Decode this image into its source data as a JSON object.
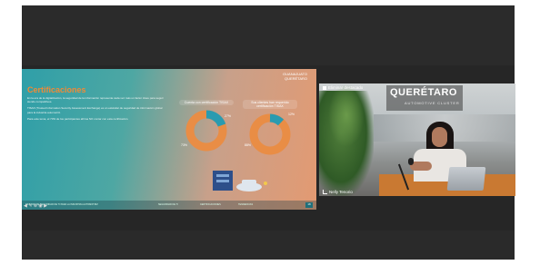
{
  "slide": {
    "logo_left": "GUANAJUATO",
    "logo_right": "QUERÉTARO",
    "title": "Certificaciones",
    "body": [
      "En la era de la digitalización, la seguridad de la información representa cada vez más un factor clave para seguir siendo competitivos.",
      "TISAX (Trusted Information Security Assessment Exchange) es un estándar de seguridad de información global para la industria automotriz.",
      "Para este tema, el 73% de los participantes afirma NO contar con esta certificación."
    ],
    "donut1_label": "Cuenta con certificación TISAX",
    "donut1_pct_a": "73%",
    "donut1_pct_b": "27%",
    "donut2_label": "Sus clientes han requerido certificación TISAX",
    "donut2_pct_a": "88%",
    "donut2_pct_b": "12%",
    "footer_a": "ESTUDIO DE SEGURIDAD DE TI PARA LA INDUSTRIA AUTOMOTRIZ",
    "footer_b": "SEGURIDAD DE TI",
    "footer_c": "CERTIFICACIONES",
    "footer_d": "TENDENCIAS",
    "page": "18"
  },
  "slide_tools": "◀ ✎ ⊕ ◉ ▶",
  "camera": {
    "overlay": "Eliminar destacado",
    "brand": "QUERÉTARO",
    "brand_sub": "AUTOMOTIVE CLUSTER",
    "participant": "Nelly Tenorio"
  },
  "colors": {
    "donut_orange": "#e98d45",
    "donut_teal": "#2a9bb0"
  }
}
